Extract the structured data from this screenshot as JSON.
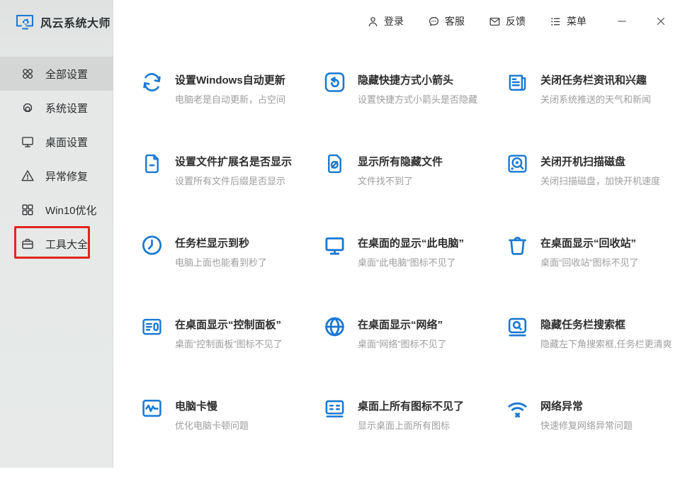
{
  "app": {
    "title": "风云系统大师",
    "logo_icon": "monitor-gear-logo"
  },
  "colors": {
    "accent_blue": "#1878d4",
    "annotation_red": "#e1261c",
    "sidebar_bg": "#e5e8e7",
    "sidebar_selected_bg": "#d3d6d5",
    "title_text": "#2d2d2d",
    "subtitle_text": "#9d9d9d"
  },
  "header": {
    "items": [
      {
        "name": "login",
        "icon": "person-icon",
        "label": "登录"
      },
      {
        "name": "customer-service",
        "icon": "chat-bubble-icon",
        "label": "客服"
      },
      {
        "name": "feedback",
        "icon": "envelope-icon",
        "label": "反馈"
      },
      {
        "name": "menu",
        "icon": "list-menu-icon",
        "label": "菜单"
      }
    ],
    "window_controls": [
      {
        "name": "minimize",
        "icon": "minimize-icon"
      },
      {
        "name": "close",
        "icon": "close-icon"
      }
    ]
  },
  "sidebar": {
    "items": [
      {
        "name": "all-settings",
        "icon": "apps-grid-icon",
        "label": "全部设置",
        "selected": true,
        "annotated": false
      },
      {
        "name": "system-settings",
        "icon": "gear-icon",
        "label": "系统设置",
        "selected": false,
        "annotated": false
      },
      {
        "name": "desktop-settings",
        "icon": "monitor-icon",
        "label": "桌面设置",
        "selected": false,
        "annotated": false
      },
      {
        "name": "error-repair",
        "icon": "warning-triangle-icon",
        "label": "异常修复",
        "selected": false,
        "annotated": false
      },
      {
        "name": "win10-optimize",
        "icon": "win-squares-icon",
        "label": "Win10优化",
        "selected": false,
        "annotated": false
      },
      {
        "name": "tools-collection",
        "icon": "toolbox-icon",
        "label": "工具大全",
        "selected": false,
        "annotated": true
      }
    ]
  },
  "grid": {
    "items": [
      {
        "name": "windows-auto-update",
        "icon": "sync-arrows-icon",
        "title": "设置Windows自动更新",
        "subtitle": "电脑老是自动更新，占空间"
      },
      {
        "name": "hide-shortcut-arrow",
        "icon": "shortcut-arrow-icon",
        "title": "隐藏快捷方式小箭头",
        "subtitle": "设置快捷方式小箭头是否隐藏"
      },
      {
        "name": "close-taskbar-news",
        "icon": "newspaper-icon",
        "title": "关闭任务栏资讯和兴趣",
        "subtitle": "关闭系统推送的天气和新闻"
      },
      {
        "name": "file-extension-display",
        "icon": "file-dash-icon",
        "title": "设置文件扩展名是否显示",
        "subtitle": "设置所有文件后缀是否显示"
      },
      {
        "name": "show-hidden-files",
        "icon": "hidden-file-icon",
        "title": "显示所有隐藏文件",
        "subtitle": "文件找不到了"
      },
      {
        "name": "disable-boot-disk-scan",
        "icon": "disk-scan-icon",
        "title": "关闭开机扫描磁盘",
        "subtitle": "关闭扫描磁盘，加快开机速度"
      },
      {
        "name": "taskbar-show-seconds",
        "icon": "clock-icon",
        "title": "任务栏显示到秒",
        "subtitle": "电脑上面也能看到秒了"
      },
      {
        "name": "show-this-pc",
        "icon": "computer-monitor-icon",
        "title": "在桌面的显示“此电脑”",
        "subtitle": "桌面“此电脑”图标不见了"
      },
      {
        "name": "show-recycle-bin",
        "icon": "trash-icon",
        "title": "在桌面显示“回收站”",
        "subtitle": "桌面“回收站”图标不见了"
      },
      {
        "name": "show-control-panel",
        "icon": "control-panel-icon",
        "title": "在桌面显示“控制面板”",
        "subtitle": "桌面“控制面板”图标不见了"
      },
      {
        "name": "show-network",
        "icon": "globe-icon",
        "title": "在桌面显示“网络”",
        "subtitle": "桌面“网络”图标不见了"
      },
      {
        "name": "hide-taskbar-search",
        "icon": "search-box-icon",
        "title": "隐藏任务栏搜索框",
        "subtitle": "隐藏左下角搜索框,任务栏更清爽"
      },
      {
        "name": "pc-slow",
        "icon": "pulse-monitor-icon",
        "title": "电脑卡慢",
        "subtitle": "优化电脑卡顿问题"
      },
      {
        "name": "desktop-icons-missing",
        "icon": "desktop-icons-icon",
        "title": "桌面上所有图标不见了",
        "subtitle": "显示桌面上面所有图标"
      },
      {
        "name": "network-error",
        "icon": "wifi-error-icon",
        "title": "网络异常",
        "subtitle": "快速修复网络异常问题"
      }
    ]
  }
}
